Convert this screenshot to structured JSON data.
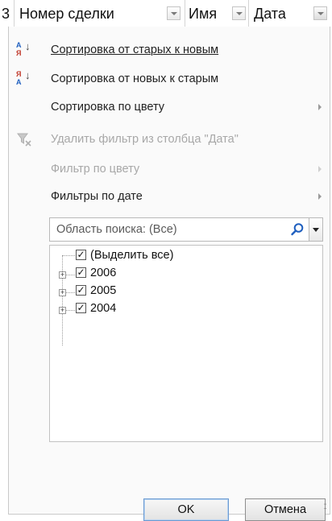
{
  "header": {
    "row_number": "3",
    "columns": [
      {
        "label": "Номер сделки"
      },
      {
        "label": "Имя"
      },
      {
        "label": "Дата"
      }
    ]
  },
  "menu": {
    "sort_asc": "Сортировка от старых к новым",
    "sort_desc": "Сортировка от новых к старым",
    "sort_color": "Сортировка по цвету",
    "clear_filter": "Удалить фильтр из столбца \"Дата\"",
    "filter_color": "Фильтр по цвету",
    "date_filters": "Фильтры по дате"
  },
  "search": {
    "placeholder": "Область поиска: (Все)"
  },
  "tree": {
    "items": [
      {
        "label": "(Выделить все)",
        "checked": true
      },
      {
        "label": "2006",
        "checked": true
      },
      {
        "label": "2005",
        "checked": true
      },
      {
        "label": "2004",
        "checked": true
      }
    ]
  },
  "buttons": {
    "ok": "OK",
    "cancel": "Отмена"
  },
  "icons": {
    "sort_asc": "sort-a-to-z-icon",
    "sort_desc": "sort-z-to-a-icon",
    "clear_filter": "clear-filter-icon",
    "search": "magnifier-icon"
  },
  "colors": {
    "accent_blue": "#1f5fbf",
    "accent_red": "#c0392b",
    "disabled_text": "#a8a8a8"
  }
}
